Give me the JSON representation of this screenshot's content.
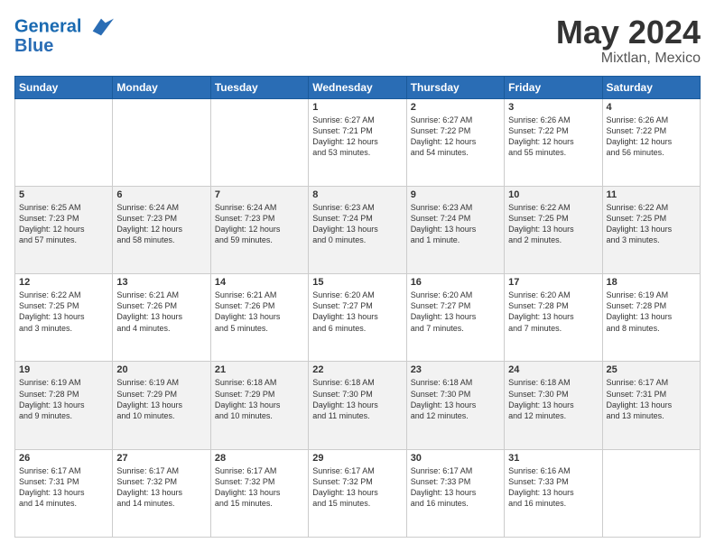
{
  "header": {
    "logo_line1": "General",
    "logo_line2": "Blue",
    "month_title": "May 2024",
    "location": "Mixtlan, Mexico"
  },
  "weekdays": [
    "Sunday",
    "Monday",
    "Tuesday",
    "Wednesday",
    "Thursday",
    "Friday",
    "Saturday"
  ],
  "weeks": [
    [
      {
        "day": "",
        "info": ""
      },
      {
        "day": "",
        "info": ""
      },
      {
        "day": "",
        "info": ""
      },
      {
        "day": "1",
        "info": "Sunrise: 6:27 AM\nSunset: 7:21 PM\nDaylight: 12 hours\nand 53 minutes."
      },
      {
        "day": "2",
        "info": "Sunrise: 6:27 AM\nSunset: 7:22 PM\nDaylight: 12 hours\nand 54 minutes."
      },
      {
        "day": "3",
        "info": "Sunrise: 6:26 AM\nSunset: 7:22 PM\nDaylight: 12 hours\nand 55 minutes."
      },
      {
        "day": "4",
        "info": "Sunrise: 6:26 AM\nSunset: 7:22 PM\nDaylight: 12 hours\nand 56 minutes."
      }
    ],
    [
      {
        "day": "5",
        "info": "Sunrise: 6:25 AM\nSunset: 7:23 PM\nDaylight: 12 hours\nand 57 minutes."
      },
      {
        "day": "6",
        "info": "Sunrise: 6:24 AM\nSunset: 7:23 PM\nDaylight: 12 hours\nand 58 minutes."
      },
      {
        "day": "7",
        "info": "Sunrise: 6:24 AM\nSunset: 7:23 PM\nDaylight: 12 hours\nand 59 minutes."
      },
      {
        "day": "8",
        "info": "Sunrise: 6:23 AM\nSunset: 7:24 PM\nDaylight: 13 hours\nand 0 minutes."
      },
      {
        "day": "9",
        "info": "Sunrise: 6:23 AM\nSunset: 7:24 PM\nDaylight: 13 hours\nand 1 minute."
      },
      {
        "day": "10",
        "info": "Sunrise: 6:22 AM\nSunset: 7:25 PM\nDaylight: 13 hours\nand 2 minutes."
      },
      {
        "day": "11",
        "info": "Sunrise: 6:22 AM\nSunset: 7:25 PM\nDaylight: 13 hours\nand 3 minutes."
      }
    ],
    [
      {
        "day": "12",
        "info": "Sunrise: 6:22 AM\nSunset: 7:25 PM\nDaylight: 13 hours\nand 3 minutes."
      },
      {
        "day": "13",
        "info": "Sunrise: 6:21 AM\nSunset: 7:26 PM\nDaylight: 13 hours\nand 4 minutes."
      },
      {
        "day": "14",
        "info": "Sunrise: 6:21 AM\nSunset: 7:26 PM\nDaylight: 13 hours\nand 5 minutes."
      },
      {
        "day": "15",
        "info": "Sunrise: 6:20 AM\nSunset: 7:27 PM\nDaylight: 13 hours\nand 6 minutes."
      },
      {
        "day": "16",
        "info": "Sunrise: 6:20 AM\nSunset: 7:27 PM\nDaylight: 13 hours\nand 7 minutes."
      },
      {
        "day": "17",
        "info": "Sunrise: 6:20 AM\nSunset: 7:28 PM\nDaylight: 13 hours\nand 7 minutes."
      },
      {
        "day": "18",
        "info": "Sunrise: 6:19 AM\nSunset: 7:28 PM\nDaylight: 13 hours\nand 8 minutes."
      }
    ],
    [
      {
        "day": "19",
        "info": "Sunrise: 6:19 AM\nSunset: 7:28 PM\nDaylight: 13 hours\nand 9 minutes."
      },
      {
        "day": "20",
        "info": "Sunrise: 6:19 AM\nSunset: 7:29 PM\nDaylight: 13 hours\nand 10 minutes."
      },
      {
        "day": "21",
        "info": "Sunrise: 6:18 AM\nSunset: 7:29 PM\nDaylight: 13 hours\nand 10 minutes."
      },
      {
        "day": "22",
        "info": "Sunrise: 6:18 AM\nSunset: 7:30 PM\nDaylight: 13 hours\nand 11 minutes."
      },
      {
        "day": "23",
        "info": "Sunrise: 6:18 AM\nSunset: 7:30 PM\nDaylight: 13 hours\nand 12 minutes."
      },
      {
        "day": "24",
        "info": "Sunrise: 6:18 AM\nSunset: 7:30 PM\nDaylight: 13 hours\nand 12 minutes."
      },
      {
        "day": "25",
        "info": "Sunrise: 6:17 AM\nSunset: 7:31 PM\nDaylight: 13 hours\nand 13 minutes."
      }
    ],
    [
      {
        "day": "26",
        "info": "Sunrise: 6:17 AM\nSunset: 7:31 PM\nDaylight: 13 hours\nand 14 minutes."
      },
      {
        "day": "27",
        "info": "Sunrise: 6:17 AM\nSunset: 7:32 PM\nDaylight: 13 hours\nand 14 minutes."
      },
      {
        "day": "28",
        "info": "Sunrise: 6:17 AM\nSunset: 7:32 PM\nDaylight: 13 hours\nand 15 minutes."
      },
      {
        "day": "29",
        "info": "Sunrise: 6:17 AM\nSunset: 7:32 PM\nDaylight: 13 hours\nand 15 minutes."
      },
      {
        "day": "30",
        "info": "Sunrise: 6:17 AM\nSunset: 7:33 PM\nDaylight: 13 hours\nand 16 minutes."
      },
      {
        "day": "31",
        "info": "Sunrise: 6:16 AM\nSunset: 7:33 PM\nDaylight: 13 hours\nand 16 minutes."
      },
      {
        "day": "",
        "info": ""
      }
    ]
  ]
}
